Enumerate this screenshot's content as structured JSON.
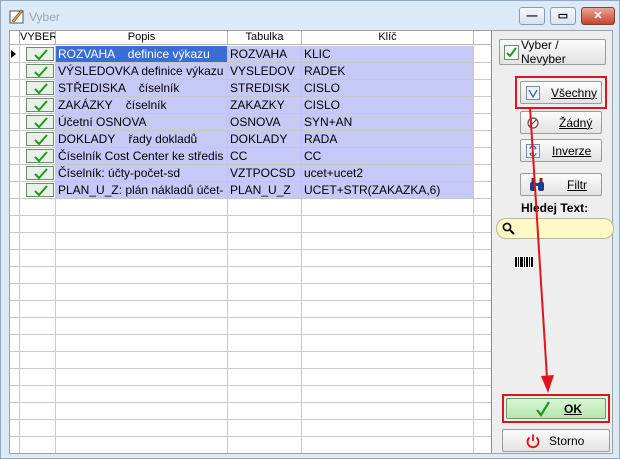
{
  "window": {
    "title": "Vyber"
  },
  "grid": {
    "columns": [
      "VYBER",
      "Popis",
      "Tabulka",
      "Klíč"
    ],
    "rows": [
      {
        "checked": true,
        "popis": "ROZVAHA    definice výkazu",
        "tabulka": "ROZVAHA",
        "klic": "KLIC",
        "selected": true
      },
      {
        "checked": true,
        "popis": "VÝSLEDOVKA definice výkazu",
        "tabulka": "VYSLEDOV",
        "klic": "RADEK"
      },
      {
        "checked": true,
        "popis": "STŘEDISKA    číselník",
        "tabulka": "STREDISK",
        "klic": "CISLO"
      },
      {
        "checked": true,
        "popis": "ZAKÁZKY    číselník",
        "tabulka": "ZAKAZKY",
        "klic": "CISLO"
      },
      {
        "checked": true,
        "popis": "Účetní OSNOVA",
        "tabulka": "OSNOVA",
        "klic": "SYN+AN"
      },
      {
        "checked": true,
        "popis": "DOKLADY    řady dokladů",
        "tabulka": "DOKLADY",
        "klic": "RADA"
      },
      {
        "checked": true,
        "popis": "Číselník Cost Center ke středis",
        "tabulka": "CC",
        "klic": "CC"
      },
      {
        "checked": true,
        "popis": "Číselník: účty-počet-sd",
        "tabulka": "VZTPOCSD",
        "klic": "ucet+ucet2"
      },
      {
        "checked": true,
        "popis": "PLAN_U_Z: plán nákladů účet-",
        "tabulka": "PLAN_U_Z",
        "klic": "UCET+STR(ZAKAZKA,6)"
      }
    ]
  },
  "panel": {
    "vyber_nevyber": "Vyber / Nevyber",
    "vsechny": "Všechny",
    "zadny": "Žádný",
    "inverze": "Inverze",
    "filtr": "Filtr",
    "hledej_label": "Hledej Text:",
    "search_value": "",
    "ok": "OK",
    "storno": "Storno"
  },
  "colors": {
    "row_fill": "#c6c8f5",
    "selection": "#3c6dd6",
    "highlight": "#e0141e",
    "ok_bg": "#c9f0c4"
  }
}
